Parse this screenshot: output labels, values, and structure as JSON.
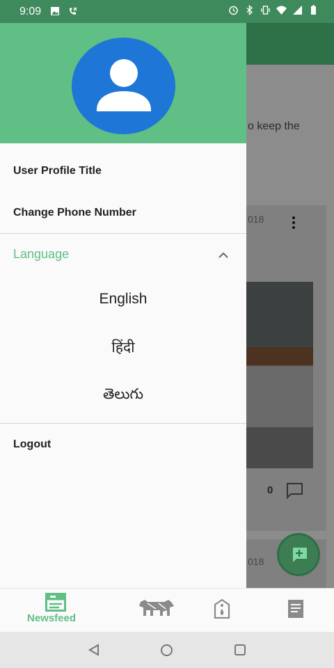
{
  "status_bar": {
    "time": "9:09",
    "left_icons": [
      "image-icon",
      "wifi-call-icon"
    ],
    "right_icons": [
      "alarm-icon",
      "bluetooth-icon",
      "vibrate-icon",
      "wifi-icon",
      "signal-icon",
      "battery-icon"
    ]
  },
  "background_app": {
    "text_fragment": "o keep the",
    "post_date_fragment_1": "018",
    "comment_count": "0",
    "post_date_fragment_2": "018"
  },
  "drawer": {
    "items": {
      "profile_title": "User Profile Title",
      "change_phone": "Change Phone Number",
      "logout": "Logout"
    },
    "language": {
      "label": "Language",
      "options": [
        "English",
        "हिंदी",
        "తెలుగు"
      ]
    }
  },
  "bottom_nav": {
    "items": [
      {
        "label": "Newsfeed",
        "icon": "newsfeed-icon",
        "active": true
      },
      {
        "label": "",
        "icon": "cattle-icon"
      },
      {
        "label": "",
        "icon": "tag-icon"
      },
      {
        "label": "",
        "icon": "document-icon"
      }
    ]
  },
  "colors": {
    "accent": "#5fbf85",
    "status_bar": "#3f8a5c",
    "avatar": "#1e76d6"
  }
}
